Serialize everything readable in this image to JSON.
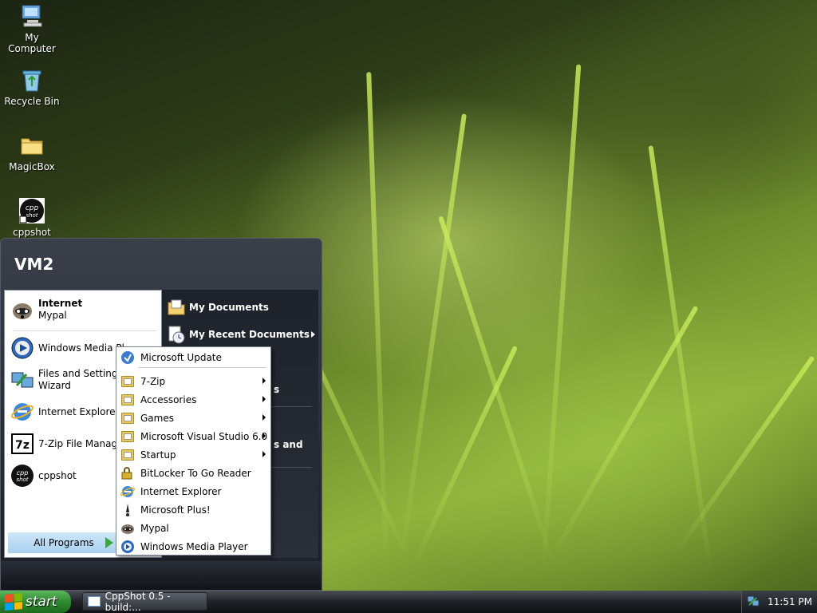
{
  "desktop": {
    "icons": [
      {
        "label": "My Computer",
        "icon": "computer-icon"
      },
      {
        "label": "Recycle Bin",
        "icon": "recycle-bin-icon"
      },
      {
        "label": "MagicBox",
        "icon": "folder-icon"
      },
      {
        "label": "cppshot",
        "icon": "cppshot-icon"
      }
    ]
  },
  "start_menu": {
    "user": "VM2",
    "pinned": [
      {
        "title": "Internet",
        "subtitle": "Mypal",
        "icon": "mypal-icon"
      }
    ],
    "recent": [
      {
        "label": "Windows Media Pl",
        "icon": "media-player-icon"
      },
      {
        "label": "Files and Settings T",
        "label2": "Wizard",
        "icon": "transfer-wizard-icon"
      },
      {
        "label": "Internet Explorer",
        "icon": "internet-explorer-icon"
      },
      {
        "label": "7-Zip File Manager",
        "icon": "7zip-icon"
      },
      {
        "label": "cppshot",
        "icon": "cppshot-icon"
      }
    ],
    "all_programs": "All Programs",
    "right": [
      {
        "label": "My Documents",
        "icon": "documents-icon"
      },
      {
        "label": "My Recent Documents",
        "icon": "recent-documents-icon"
      }
    ],
    "right_partial": [
      "s",
      "s and"
    ]
  },
  "programs_menu": [
    {
      "label": "Microsoft Update",
      "icon": "update-icon",
      "submenu": false
    },
    {
      "label": "7-Zip",
      "icon": "folder-icon",
      "submenu": true
    },
    {
      "label": "Accessories",
      "icon": "folder-icon",
      "submenu": true
    },
    {
      "label": "Games",
      "icon": "folder-icon",
      "submenu": true
    },
    {
      "label": "Microsoft Visual Studio 6.0",
      "icon": "folder-icon",
      "submenu": true
    },
    {
      "label": "Startup",
      "icon": "folder-icon",
      "submenu": true
    },
    {
      "label": "BitLocker To Go Reader",
      "icon": "bitlocker-icon",
      "submenu": false
    },
    {
      "label": "Internet Explorer",
      "icon": "internet-explorer-icon",
      "submenu": false
    },
    {
      "label": "Microsoft Plus!",
      "icon": "plus-icon",
      "submenu": false
    },
    {
      "label": "Mypal",
      "icon": "mypal-icon",
      "submenu": false
    },
    {
      "label": "Windows Media Player",
      "icon": "media-player-icon",
      "submenu": false
    }
  ],
  "taskbar": {
    "start_label": "start",
    "window_button": "CppShot 0.5 - build:...",
    "clock": "11:51 PM"
  },
  "colors": {
    "accent_green": "#2f8a2f",
    "menu_highlight": "#a8d0f0"
  }
}
